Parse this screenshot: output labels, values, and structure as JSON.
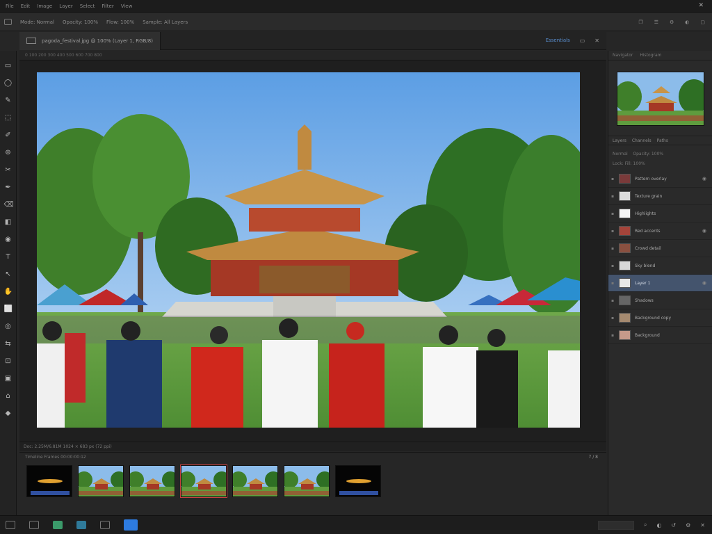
{
  "menu": {
    "items": [
      "File",
      "Edit",
      "Image",
      "Layer",
      "Select",
      "Filter",
      "View"
    ],
    "window_btn": "✕"
  },
  "options": {
    "items": [
      "Mode: Normal",
      "Opacity: 100%",
      "Flow: 100%",
      "Sample: All Layers"
    ],
    "right_icons": [
      "❐",
      "☰",
      "⚙",
      "◐",
      "▢"
    ]
  },
  "document": {
    "tab_label": "pagoda_festival.jpg @ 100% (Layer 1, RGB/8)",
    "right_flag": "Essentials",
    "ruler": "0 100 200 300 400 500 600 700 800"
  },
  "tools": [
    "▭",
    "◯",
    "✎",
    "⬚",
    "✐",
    "⊕",
    "✂",
    "✒",
    "⌫",
    "◧",
    "◉",
    "T",
    "↖",
    "✋",
    "⬜",
    "◎",
    "⇆",
    "⊡",
    "▣",
    "⌂",
    "◆"
  ],
  "status": {
    "text": "Doc: 2.25M/6.81M    1024 × 683 px (72 ppi)"
  },
  "filmstrip": {
    "header": "Timeline    Frames    00:00:00:12",
    "counter": "7 / 8",
    "frame_count": 7,
    "selected_index": 3
  },
  "bottom": {
    "buttons": [
      "green",
      "teal",
      "plain",
      "blue"
    ],
    "right_icons": [
      "⌕",
      "◐",
      "↺",
      "⚙",
      "✕"
    ]
  },
  "right_panel": {
    "nav_tabs": [
      "Navigator",
      "Histogram"
    ],
    "panel_tabs": [
      "Layers",
      "Channels",
      "Paths"
    ],
    "blend_mode": "Normal",
    "opacity_label": "Opacity: 100%",
    "fill_label": "Lock:  Fill: 100%",
    "active_layer_index": 6,
    "layers": [
      {
        "name": "Pattern overlay",
        "thumb": "#7a3a3a",
        "visible": true
      },
      {
        "name": "Texture grain",
        "thumb": "#dddddd",
        "visible": false
      },
      {
        "name": "Highlights",
        "thumb": "#f4f4f4",
        "visible": false
      },
      {
        "name": "Red accents",
        "thumb": "#a5443a",
        "visible": true
      },
      {
        "name": "Crowd detail",
        "thumb": "#8a5040",
        "visible": false
      },
      {
        "name": "Sky blend",
        "thumb": "#d8d8d8",
        "visible": false
      },
      {
        "name": "Layer 1",
        "thumb": "#e8e8e8",
        "visible": true
      },
      {
        "name": "Shadows",
        "thumb": "#666666",
        "visible": false
      },
      {
        "name": "Background copy",
        "thumb": "#a58a70",
        "visible": false
      },
      {
        "name": "Background",
        "thumb": "#c69a8a",
        "visible": false
      }
    ]
  }
}
